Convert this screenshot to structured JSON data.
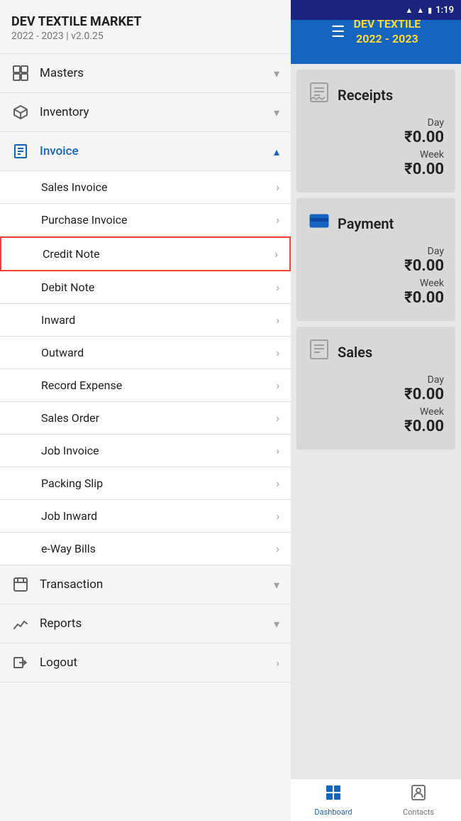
{
  "statusBar": {
    "time": "1:19",
    "icons": [
      "wifi",
      "signal",
      "battery"
    ]
  },
  "header": {
    "title": "DEV TEXTILE\n2022 - 2023",
    "line1": "DEV TEXTILE",
    "line2": "2022 - 2023"
  },
  "sidebar": {
    "company": "DEV TEXTILE MARKET",
    "yearVersion": "2022 - 2023 | v2.0.25",
    "navItems": [
      {
        "id": "masters",
        "label": "Masters",
        "hasIcon": true,
        "iconType": "grid",
        "expanded": false
      },
      {
        "id": "inventory",
        "label": "Inventory",
        "hasIcon": true,
        "iconType": "basket",
        "expanded": false
      },
      {
        "id": "invoice",
        "label": "Invoice",
        "hasIcon": true,
        "iconType": "list",
        "expanded": true,
        "active": true
      }
    ],
    "subItems": [
      {
        "id": "sales-invoice",
        "label": "Sales Invoice",
        "highlighted": false
      },
      {
        "id": "purchase-invoice",
        "label": "Purchase Invoice",
        "highlighted": false
      },
      {
        "id": "credit-note",
        "label": "Credit Note",
        "highlighted": true
      },
      {
        "id": "debit-note",
        "label": "Debit Note",
        "highlighted": false
      },
      {
        "id": "inward",
        "label": "Inward",
        "highlighted": false
      },
      {
        "id": "outward",
        "label": "Outward",
        "highlighted": false
      },
      {
        "id": "record-expense",
        "label": "Record Expense",
        "highlighted": false
      },
      {
        "id": "sales-order",
        "label": "Sales Order",
        "highlighted": false
      },
      {
        "id": "job-invoice",
        "label": "Job Invoice",
        "highlighted": false
      },
      {
        "id": "packing-slip",
        "label": "Packing Slip",
        "highlighted": false
      },
      {
        "id": "job-inward",
        "label": "Job Inward",
        "highlighted": false
      },
      {
        "id": "eway-bills",
        "label": "e-Way Bills",
        "highlighted": false
      }
    ],
    "bottomItems": [
      {
        "id": "transaction",
        "label": "Transaction",
        "iconType": "transaction",
        "expanded": false
      },
      {
        "id": "reports",
        "label": "Reports",
        "iconType": "reports",
        "expanded": false
      },
      {
        "id": "logout",
        "label": "Logout",
        "iconType": "logout",
        "expanded": false
      }
    ]
  },
  "cards": [
    {
      "id": "receipts",
      "title": "Receipts",
      "iconType": "receipt",
      "dayLabel": "Day",
      "dayValue": "₹0.00",
      "weekLabel": "Week",
      "weekValue": "₹0.00"
    },
    {
      "id": "payment",
      "title": "Payment",
      "iconType": "payment",
      "dayLabel": "Day",
      "dayValue": "₹0.00",
      "weekLabel": "Week",
      "weekValue": "₹0.00"
    },
    {
      "id": "sales",
      "title": "Sales",
      "iconType": "sales",
      "dayLabel": "Day",
      "dayValue": "₹0.00",
      "weekLabel": "Week",
      "weekValue": "₹0.00"
    }
  ],
  "bottomNav": [
    {
      "id": "dashboard",
      "label": "Dashboard",
      "iconType": "dashboard",
      "active": true
    },
    {
      "id": "contacts",
      "label": "Contacts",
      "iconType": "contacts",
      "active": false
    }
  ]
}
